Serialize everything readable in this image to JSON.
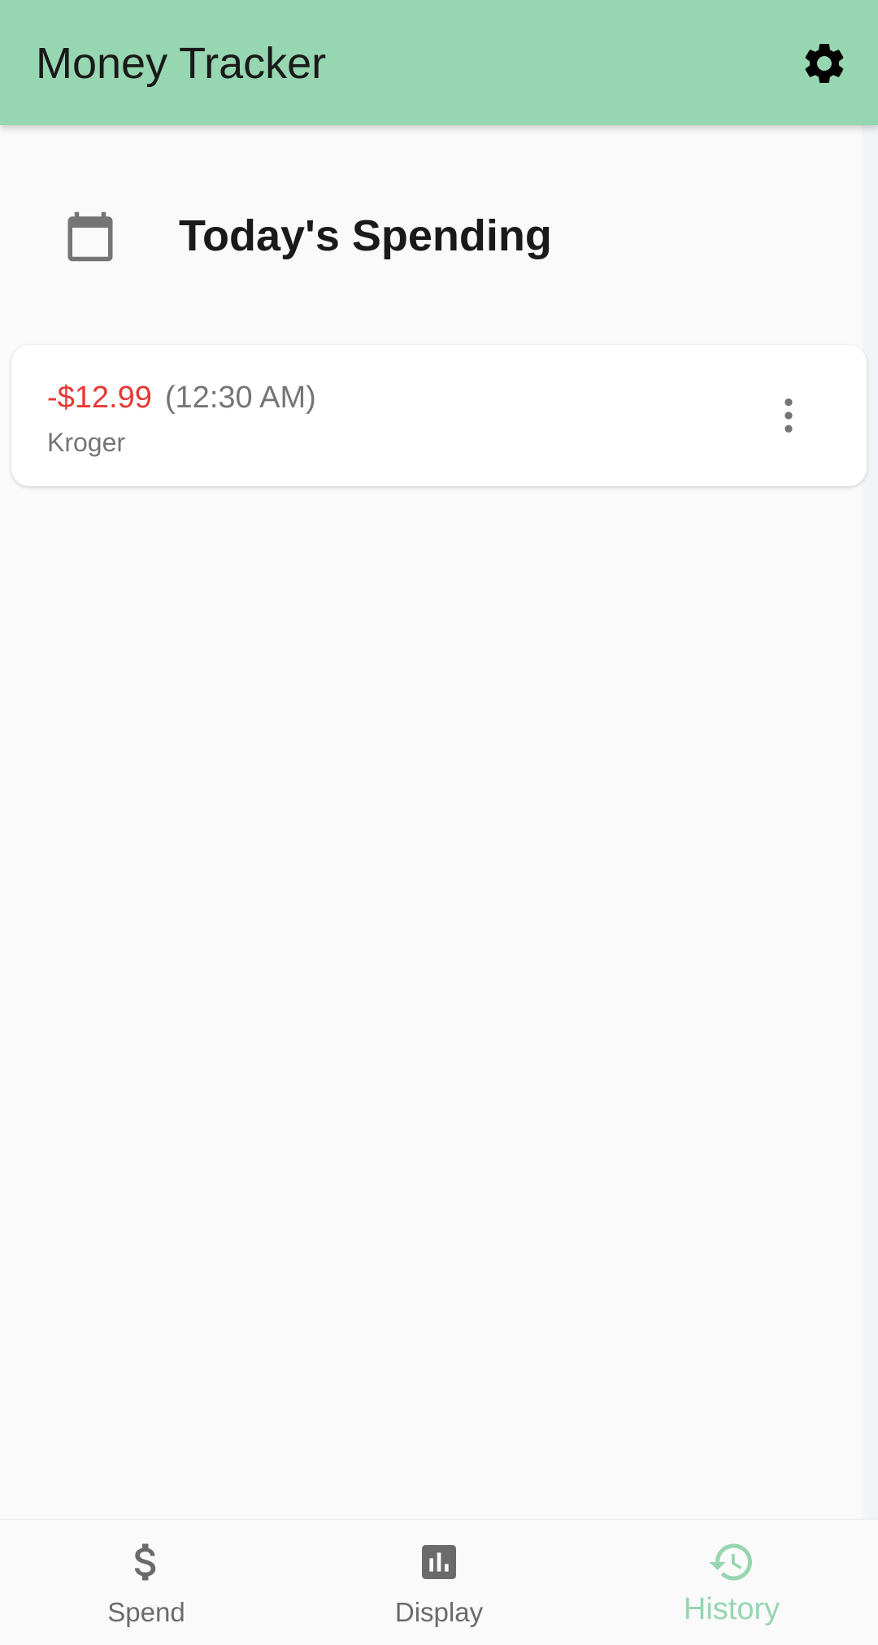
{
  "app_bar": {
    "title": "Money Tracker",
    "settings_icon": "gear-icon",
    "background_color": "#96d6b1"
  },
  "section": {
    "icon": "calendar-icon",
    "title": "Today's Spending"
  },
  "transactions": [
    {
      "amount": "-$12.99",
      "time": "(12:30 AM)",
      "merchant": "Kroger",
      "amount_color": "#e53935",
      "menu_icon": "more-vertical-icon"
    }
  ],
  "bottom_nav": {
    "active_color": "#96d6b1",
    "items": [
      {
        "label": "Spend",
        "icon": "dollar-icon",
        "active": false
      },
      {
        "label": "Display",
        "icon": "bar-chart-icon",
        "active": false
      },
      {
        "label": "History",
        "icon": "history-icon",
        "active": true
      }
    ]
  }
}
